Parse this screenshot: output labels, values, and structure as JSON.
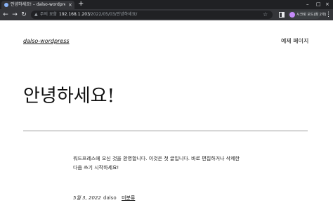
{
  "browser": {
    "tab_title": "안녕하세요! – dalso-wordpress",
    "tab_close": "×",
    "new_tab": "+",
    "window_controls": {
      "minimize": "–",
      "maximize": "□",
      "close": "×"
    },
    "nav": {
      "back": "←",
      "forward": "→",
      "reload": "↻"
    },
    "security_label": "주의 요함",
    "url_host": "192.168.1.203",
    "url_path": "/2022/05/03/안녕하세요/",
    "profile_name": "시크릿 모드(창 2개)",
    "menu": "⋮",
    "star": "☆",
    "lock": "▲"
  },
  "site": {
    "title": "dalso-wordpress",
    "nav_link": "예제 페이지"
  },
  "post": {
    "title": "안녕하세요!",
    "body_line1": "워드프레스에 오신 것을 환영합니다. 이것은 첫 글입니다. 바로 편집하거나 삭제한",
    "body_line2": "다음 쓰기 시작하세요!",
    "date": "5월 3, 2022",
    "author": "dalso",
    "category": "미분류"
  },
  "colors": {
    "chrome_dark": "#202124",
    "chrome_toolbar": "#35363a",
    "page_bg": "#ffffff",
    "text": "#111111",
    "avatar": "#c58af9"
  }
}
